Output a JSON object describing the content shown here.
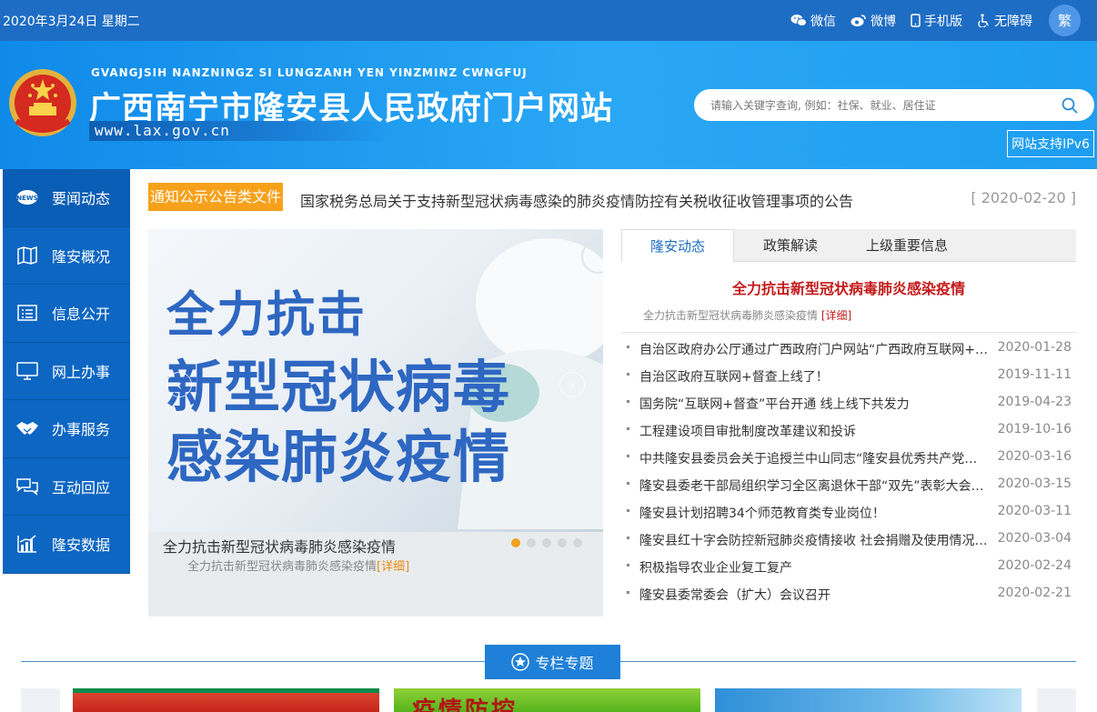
{
  "topbar": {
    "date": "2020年3月24日 星期二",
    "links": [
      {
        "label": "微信",
        "icon": "wechat-icon"
      },
      {
        "label": "微博",
        "icon": "weibo-icon"
      },
      {
        "label": "手机版",
        "icon": "mobile-icon"
      },
      {
        "label": "无障碍",
        "icon": "accessibility-icon"
      }
    ],
    "traditional": "繁"
  },
  "header": {
    "pinyin": "GVANGJSIH NANZNINGZ SI LUNGZANH YEN YINZMINZ CWNGFUJ",
    "title": "广西南宁市隆安县人民政府门户网站",
    "domain": "www.lax.gov.cn",
    "search_placeholder": "请输入关键字查询, 例如：社保、就业、居住证",
    "ipv6": "网站支持IPv6"
  },
  "nav": [
    {
      "label": "要闻动态",
      "icon": "news-icon"
    },
    {
      "label": "隆安概况",
      "icon": "map-icon"
    },
    {
      "label": "信息公开",
      "icon": "document-list-icon"
    },
    {
      "label": "网上办事",
      "icon": "monitor-icon"
    },
    {
      "label": "办事服务",
      "icon": "handshake-icon"
    },
    {
      "label": "互动回应",
      "icon": "chat-icon"
    },
    {
      "label": "隆安数据",
      "icon": "chart-icon"
    }
  ],
  "notice": {
    "tag": "通知公示公告类文件",
    "text": "国家税务总局关于支持新型冠状病毒感染的肺炎疫情防控有关税收征收管理事项的公告",
    "date": "[ 2020-02-20 ]"
  },
  "carousel": {
    "line1": "全力抗击",
    "line2": "新型冠状病毒",
    "line3": "感染肺炎疫情",
    "caption": "全力抗击新型冠状病毒肺炎感染疫情",
    "subcaption": "全力抗击新型冠状病毒肺炎感染疫情",
    "more": "[详细]",
    "prev": "‹",
    "next": "›"
  },
  "news": {
    "tabs": [
      "隆安动态",
      "政策解读",
      "上级重要信息"
    ],
    "headline": "全力抗击新型冠状病毒肺炎感染疫情",
    "headline_sub": "全力抗击新型冠状病毒肺炎感染疫情",
    "headline_more": "[详细]",
    "items": [
      {
        "title": "自治区政府办公厅通过广西政府门户网站“广西政府互联网+督查”平台开通",
        "date": "2020-01-28"
      },
      {
        "title": "自治区政府互联网+督查上线了！",
        "date": "2019-11-11"
      },
      {
        "title": "国务院“互联网+督查”平台开通 线上线下共发力",
        "date": "2019-04-23"
      },
      {
        "title": "工程建设项目审批制度改革建议和投诉",
        "date": "2019-10-16"
      },
      {
        "title": "中共隆安县委员会关于追授兰中山同志“隆安县优秀共产党员”称号的决定",
        "date": "2020-03-16"
      },
      {
        "title": "隆安县委老干部局组织学习全区离退休干部“双先”表彰大会精神",
        "date": "2020-03-15"
      },
      {
        "title": "隆安县计划招聘34个师范教育类专业岗位！",
        "date": "2020-03-11"
      },
      {
        "title": "隆安县红十字会防控新冠肺炎疫情接收 社会捐赠及使用情况公示",
        "date": "2020-03-04"
      },
      {
        "title": "积极指导农业企业复工复产",
        "date": "2020-02-24"
      },
      {
        "title": "隆安县委常委会（扩大）会议召开",
        "date": "2020-02-21"
      }
    ]
  },
  "special": {
    "label": "专栏专题",
    "banner2_text": "疫情防控"
  }
}
